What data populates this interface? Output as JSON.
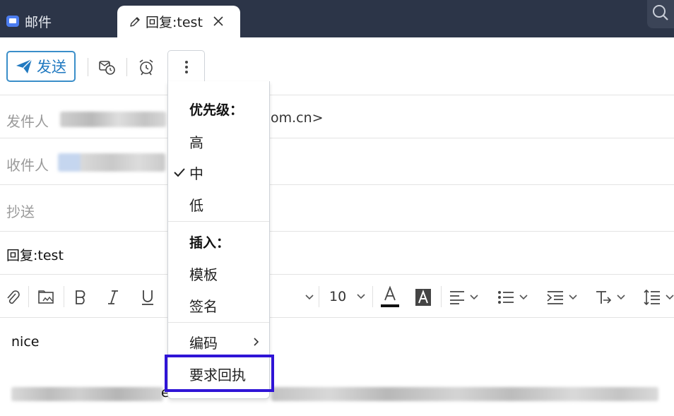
{
  "tabs": [
    {
      "label": "邮件",
      "icon": "mail-icon",
      "active": false
    },
    {
      "label": "回复:test",
      "icon": "pencil-icon",
      "active": true
    }
  ],
  "toolbar": {
    "send_label": "发送",
    "icons": [
      "schedule-send-icon",
      "alarm-clock-icon",
      "more-vertical-icon"
    ]
  },
  "fields": {
    "from_label": "发件人",
    "from_value_tail": "om.cn>",
    "to_label": "收件人",
    "cc_label": "抄送",
    "subject": "回复:test"
  },
  "editor": {
    "font_size": "10",
    "body_line1": "nice",
    "body_fragment": "e",
    "icons": [
      "attachment-icon",
      "image-icon",
      "bold-icon",
      "italic-icon",
      "underline-icon",
      "font-color-icon",
      "highlight-color-icon",
      "align-icon",
      "bullet-list-icon",
      "indent-icon",
      "text-direction-icon",
      "line-height-icon"
    ]
  },
  "menu": {
    "priority_header": "优先级：",
    "priority_options": [
      {
        "label": "高",
        "checked": false
      },
      {
        "label": "中",
        "checked": true
      },
      {
        "label": "低",
        "checked": false
      }
    ],
    "insert_header": "插入：",
    "insert_options": [
      {
        "label": "模板"
      },
      {
        "label": "签名"
      }
    ],
    "encoding_label": "编码",
    "receipt_label": "要求回执"
  },
  "colors": {
    "tabbar_bg": "#2c3548",
    "accent": "#2079c0",
    "highlight_border": "#2f14d6"
  }
}
